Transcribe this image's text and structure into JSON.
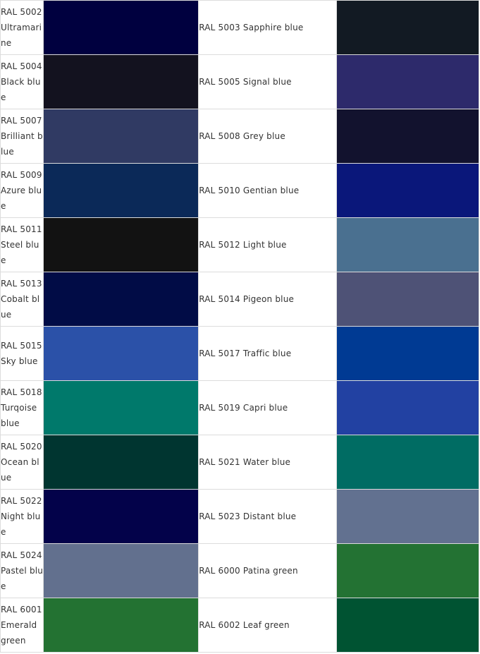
{
  "rows": [
    {
      "left": {
        "name": "RAL 5002 Ultramarine",
        "color": "#00003f"
      },
      "right": {
        "name": "RAL 5003 Sapphire blue",
        "color": "#121a23"
      }
    },
    {
      "left": {
        "name": "RAL 5004 Black blue",
        "color": "#13121f"
      },
      "right": {
        "name": "RAL 5005 Signal blue",
        "color": "#2d2a6b"
      }
    },
    {
      "left": {
        "name": "RAL 5007 Brilliant blue",
        "color": "#303a63"
      },
      "right": {
        "name": "RAL 5008 Grey blue",
        "color": "#12122e"
      }
    },
    {
      "left": {
        "name": "RAL 5009 Azure blue",
        "color": "#0b2958"
      },
      "right": {
        "name": "RAL 5010 Gentian blue",
        "color": "#0a177a"
      }
    },
    {
      "left": {
        "name": "RAL 5011 Steel blue",
        "color": "#121212"
      },
      "right": {
        "name": "RAL 5012 Light blue",
        "color": "#4a7090"
      }
    },
    {
      "left": {
        "name": "RAL 5013 Cobalt blue",
        "color": "#010c46"
      },
      "right": {
        "name": "RAL 5014 Pigeon blue",
        "color": "#4e5276"
      }
    },
    {
      "left": {
        "name": "RAL 5015 Sky blue",
        "color": "#2b51a8"
      },
      "right": {
        "name": "RAL 5017 Traffic blue",
        "color": "#003a93"
      }
    },
    {
      "left": {
        "name": "RAL 5018 Turqoise blue",
        "color": "#00796b"
      },
      "right": {
        "name": "RAL 5019 Capri blue",
        "color": "#2241a2"
      }
    },
    {
      "left": {
        "name": "RAL 5020 Ocean blue",
        "color": "#003530"
      },
      "right": {
        "name": "RAL 5021 Water blue",
        "color": "#006c63"
      }
    },
    {
      "left": {
        "name": "RAL 5022 Night blue",
        "color": "#03024a"
      },
      "right": {
        "name": "RAL 5023 Distant blue",
        "color": "#627190"
      }
    },
    {
      "left": {
        "name": "RAL 5024 Pastel blue",
        "color": "#62708e"
      },
      "right": {
        "name": "RAL 6000 Patina green",
        "color": "#237233"
      }
    },
    {
      "left": {
        "name": "RAL 6001 Emerald green",
        "color": "#237232"
      },
      "right": {
        "name": "RAL 6002 Leaf green",
        "color": "#005332"
      }
    }
  ]
}
